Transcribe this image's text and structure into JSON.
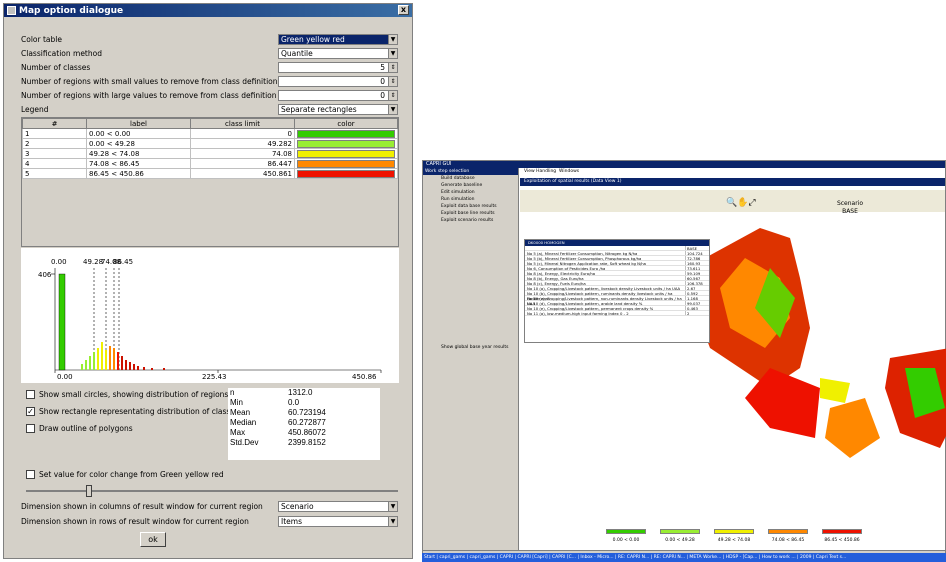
{
  "dialog": {
    "title": "Map option dialogue",
    "close": "x",
    "fields": [
      {
        "label": "Color table",
        "value": "Green yellow red",
        "kind": "select",
        "selected": true
      },
      {
        "label": "Classification method",
        "value": "Quantile",
        "kind": "select"
      },
      {
        "label": "Number of classes",
        "value": "5",
        "kind": "spin"
      },
      {
        "label": "Number of regions with small values to remove from class definition",
        "value": "0",
        "kind": "spin"
      },
      {
        "label": "Number of regions with large values to remove from class definition",
        "value": "0",
        "kind": "spin"
      },
      {
        "label": "Legend",
        "value": "Separate rectangles",
        "kind": "select"
      }
    ],
    "table": {
      "headers": [
        "#",
        "label",
        "class limit",
        "color"
      ],
      "rows": [
        {
          "n": "1",
          "label": "0.00 < 0.00",
          "limit": "0",
          "color": "#33cc00"
        },
        {
          "n": "2",
          "label": "0.00 < 49.28",
          "limit": "49.282",
          "color": "#99ee33"
        },
        {
          "n": "3",
          "label": "49.28 < 74.08",
          "limit": "74.08",
          "color": "#f0f000"
        },
        {
          "n": "4",
          "label": "74.08 < 86.45",
          "limit": "86.447",
          "color": "#ff8800"
        },
        {
          "n": "5",
          "label": "86.45 < 450.86",
          "limit": "450.861",
          "color": "#ee1100"
        }
      ]
    },
    "histogram": {
      "top_labels": [
        "0.00",
        "49.28",
        "74.08",
        "86.45"
      ],
      "ymax": "406",
      "x_ticks": [
        "0.00",
        "225.43",
        "450.86"
      ]
    },
    "options": [
      {
        "label": "Show small circles, showing distribution of regions",
        "checked": false
      },
      {
        "label": "Show rectangle representating distribution of classes",
        "checked": true
      },
      {
        "label": "Draw outline of polygons",
        "checked": false
      }
    ],
    "stats": [
      {
        "k": "n",
        "v": "1312.0"
      },
      {
        "k": "Min",
        "v": "0.0"
      },
      {
        "k": "Mean",
        "v": "60.723194"
      },
      {
        "k": "Median",
        "v": "60.272877"
      },
      {
        "k": "Max",
        "v": "450.86072"
      },
      {
        "k": "Std.Dev",
        "v": "2399.8152"
      }
    ],
    "color_change_label": "Set value for color change from Green yellow red",
    "columns_label": "Dimension shown in columns of result window for current region",
    "columns_value": "Scenario",
    "rows_label": "Dimension shown in rows of result window for current region",
    "rows_value": "Items",
    "ok": "ok"
  },
  "capri": {
    "title": "CAPRI GUI",
    "menu": [
      "View Handling",
      "Windows"
    ],
    "sidebar_header": "Work step selection",
    "sidebar_items": [
      "Build database",
      "Generate baseline",
      "Edit simulation",
      "Run simulation",
      "Exploit data base results",
      "Exploit base line results",
      "Exploit scenario results"
    ],
    "sidebar_footer": "Show global base year results",
    "panel_title": "Exploitation of spatial results (Data View 1)",
    "map_title": "Scenario",
    "map_sub": "BASE",
    "popup_title": "DK0000 HOMOGEN",
    "popup_col": "BASE",
    "popup_rows": [
      {
        "k": "No 5 (a), Mineral Fertilizer Consumption, Nitrogen kg N/ha",
        "v": "104.724"
      },
      {
        "k": "No 5 (b), Mineral Fertilizer Consumption, Phosphorous kg/ha",
        "v": "72.786"
      },
      {
        "k": "No 5 (c), Mineral Nitrogen Application rate, Soft wheat kg N/ha",
        "v": "160.93"
      },
      {
        "k": "No 6, Consumption of Pesticides Euro /ha",
        "v": "73.611"
      },
      {
        "k": "No 8 (a), Energy, Electricity Euro/ha",
        "v": "59.109"
      },
      {
        "k": "No 8 (b), Energy, Gas Euro/ha",
        "v": "60.567"
      },
      {
        "k": "No 8 (c), Energy, Fuels Euro/ha",
        "v": "106.378"
      },
      {
        "k": "No 10 (a), Cropping/Livestock pattern, livestock density Livestock units / ha UAA",
        "v": "2.67"
      },
      {
        "k": "No 10 (b), Cropping/Livestock pattern, ruminants density livestock units / ha Fodder area",
        "v": "0.592"
      },
      {
        "k": "No 10 (c), Cropping/Livestock pattern, non-ruminants density Livestock units / ha UAA",
        "v": "1.168"
      },
      {
        "k": "No 10 (d), Cropping/Livestock pattern, arable land density %",
        "v": "99.037"
      },
      {
        "k": "No 10 (e), Cropping/Livestock pattern, permanent crops density %",
        "v": "0.463"
      },
      {
        "k": "No 11 (a), low-medium-high input farming Index 0 - 2",
        "v": "2"
      }
    ],
    "legend": [
      "0.00 < 0.00",
      "0.00 < 49.28",
      "49.28 < 74.08",
      "74.08 < 86.45",
      "86.45 < 450.86"
    ],
    "status": [
      "CAPRI GUI Version 1.2.3, March 2007",
      "User name : Wolfgang Britz",
      "User type : Administrator"
    ],
    "taskbar": "Start | capri_gams | capri_gams | CAPRI | CAPRI [Capri] | CAPRI [C... | Inbox - Micro... | RE: CAPRI N... | RE: CAPRI N... | META Worke... | HDSP - [Cap... | How to work ... | 2009 | Capri Text s..."
  }
}
